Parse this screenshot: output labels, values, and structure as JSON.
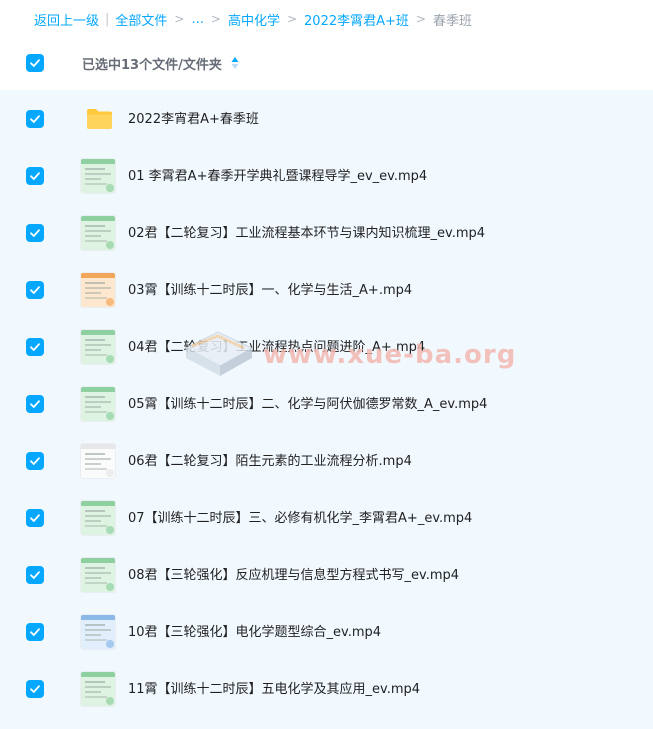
{
  "breadcrumb": {
    "back": "返回上一级",
    "all_files": "全部文件",
    "ellipsis": "...",
    "level1": "高中化学",
    "level2": "2022李霄君A+班",
    "current": "春季班"
  },
  "header": {
    "selected_label": "已选中13个文件/文件夹"
  },
  "files": [
    {
      "name": "2022李宵君A+春季班",
      "type": "folder"
    },
    {
      "name": "01 李霄君A+春季开学典礼暨课程导学_ev_ev.mp4",
      "type": "video",
      "thumb": "green"
    },
    {
      "name": "02君【二轮复习】工业流程基本环节与课内知识梳理_ev.mp4",
      "type": "video",
      "thumb": "green"
    },
    {
      "name": "03霄【训练十二时辰】一、化学与生活_A+.mp4",
      "type": "video",
      "thumb": "orange"
    },
    {
      "name": "04君【二轮复习】工业流程热点问题进阶_A+.mp4",
      "type": "video",
      "thumb": "green"
    },
    {
      "name": "05霄【训练十二时辰】二、化学与阿伏伽德罗常数_A_ev.mp4",
      "type": "video",
      "thumb": "green"
    },
    {
      "name": "06君【二轮复习】陌生元素的工业流程分析.mp4",
      "type": "video",
      "thumb": "white"
    },
    {
      "name": "07【训练十二时辰】三、必修有机化学_李霄君A+_ev.mp4",
      "type": "video",
      "thumb": "green"
    },
    {
      "name": "08君【三轮强化】反应机理与信息型方程式书写_ev.mp4",
      "type": "video",
      "thumb": "green"
    },
    {
      "name": "10君【三轮强化】电化学题型综合_ev.mp4",
      "type": "video",
      "thumb": "blue"
    },
    {
      "name": "11霄【训练十二时辰】五电化学及其应用_ev.mp4",
      "type": "video",
      "thumb": "green"
    }
  ],
  "watermark": "www.xue-ba.org",
  "colors": {
    "accent": "#06a7ff",
    "list_bg": "#f1f9ff",
    "folder": "#ffc93c",
    "watermark": "#f3b8b0"
  }
}
